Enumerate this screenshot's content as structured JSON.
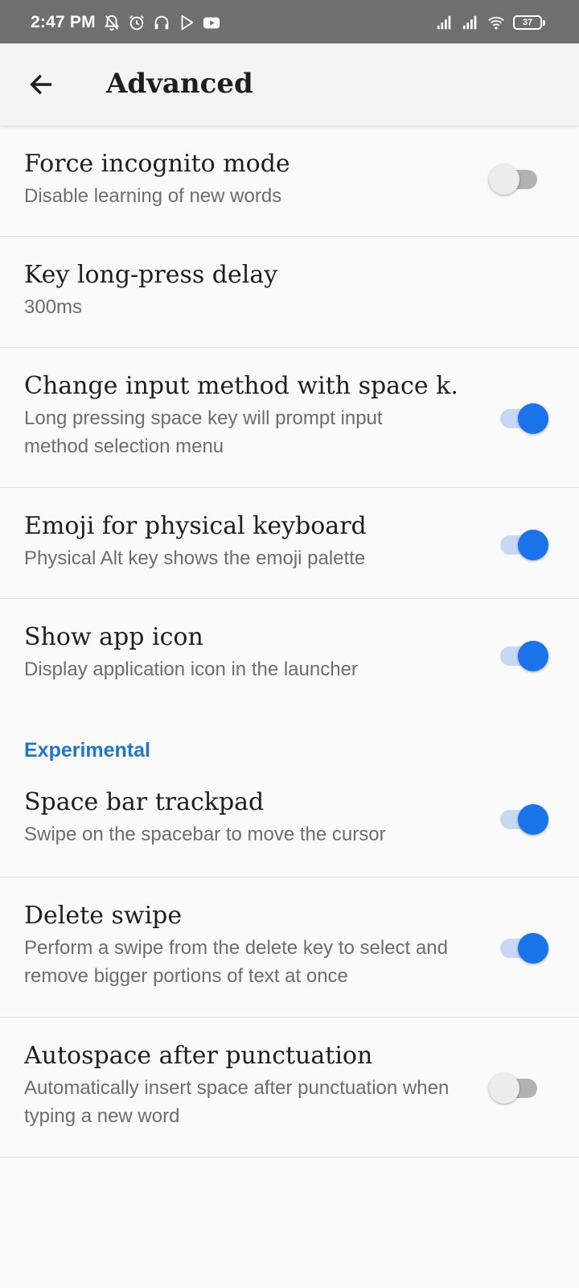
{
  "status_bar": {
    "time": "2:47 PM",
    "battery": "37",
    "left_icons": [
      "mute-bell-icon",
      "alarm-icon",
      "headset-icon",
      "play-store-icon",
      "youtube-icon"
    ],
    "right_icons": [
      "signal-icon",
      "signal-icon",
      "wifi-icon",
      "battery-icon"
    ]
  },
  "app_bar": {
    "back_icon": "arrow-back-icon",
    "title": "Advanced"
  },
  "settings": [
    {
      "title": "Force incognito mode",
      "subtitle": "Disable learning of new words",
      "toggle": false
    },
    {
      "title": "Key long-press delay",
      "subtitle": "300ms"
    },
    {
      "title": "Change input method with space k..",
      "subtitle": "Long pressing space key will prompt input method selection menu",
      "toggle": true
    },
    {
      "title": "Emoji for physical keyboard",
      "subtitle": "Physical Alt key shows the emoji palette",
      "toggle": true
    },
    {
      "title": "Show app icon",
      "subtitle": "Display application icon in the launcher",
      "toggle": true
    }
  ],
  "experimental": {
    "header": "Experimental",
    "items": [
      {
        "title": "Space bar trackpad",
        "subtitle": "Swipe on the spacebar to move the cursor",
        "toggle": true
      },
      {
        "title": "Delete swipe",
        "subtitle": "Perform a swipe from the delete key to select and remove bigger portions of text at once",
        "toggle": true
      },
      {
        "title": "Autospace after punctuation",
        "subtitle": "Automatically insert space after punctuation when typing a new word",
        "toggle": false
      }
    ]
  },
  "colors": {
    "accent": "#1a73e8",
    "section_header": "#1f76c7",
    "status_bar": "#6f6f6f"
  }
}
